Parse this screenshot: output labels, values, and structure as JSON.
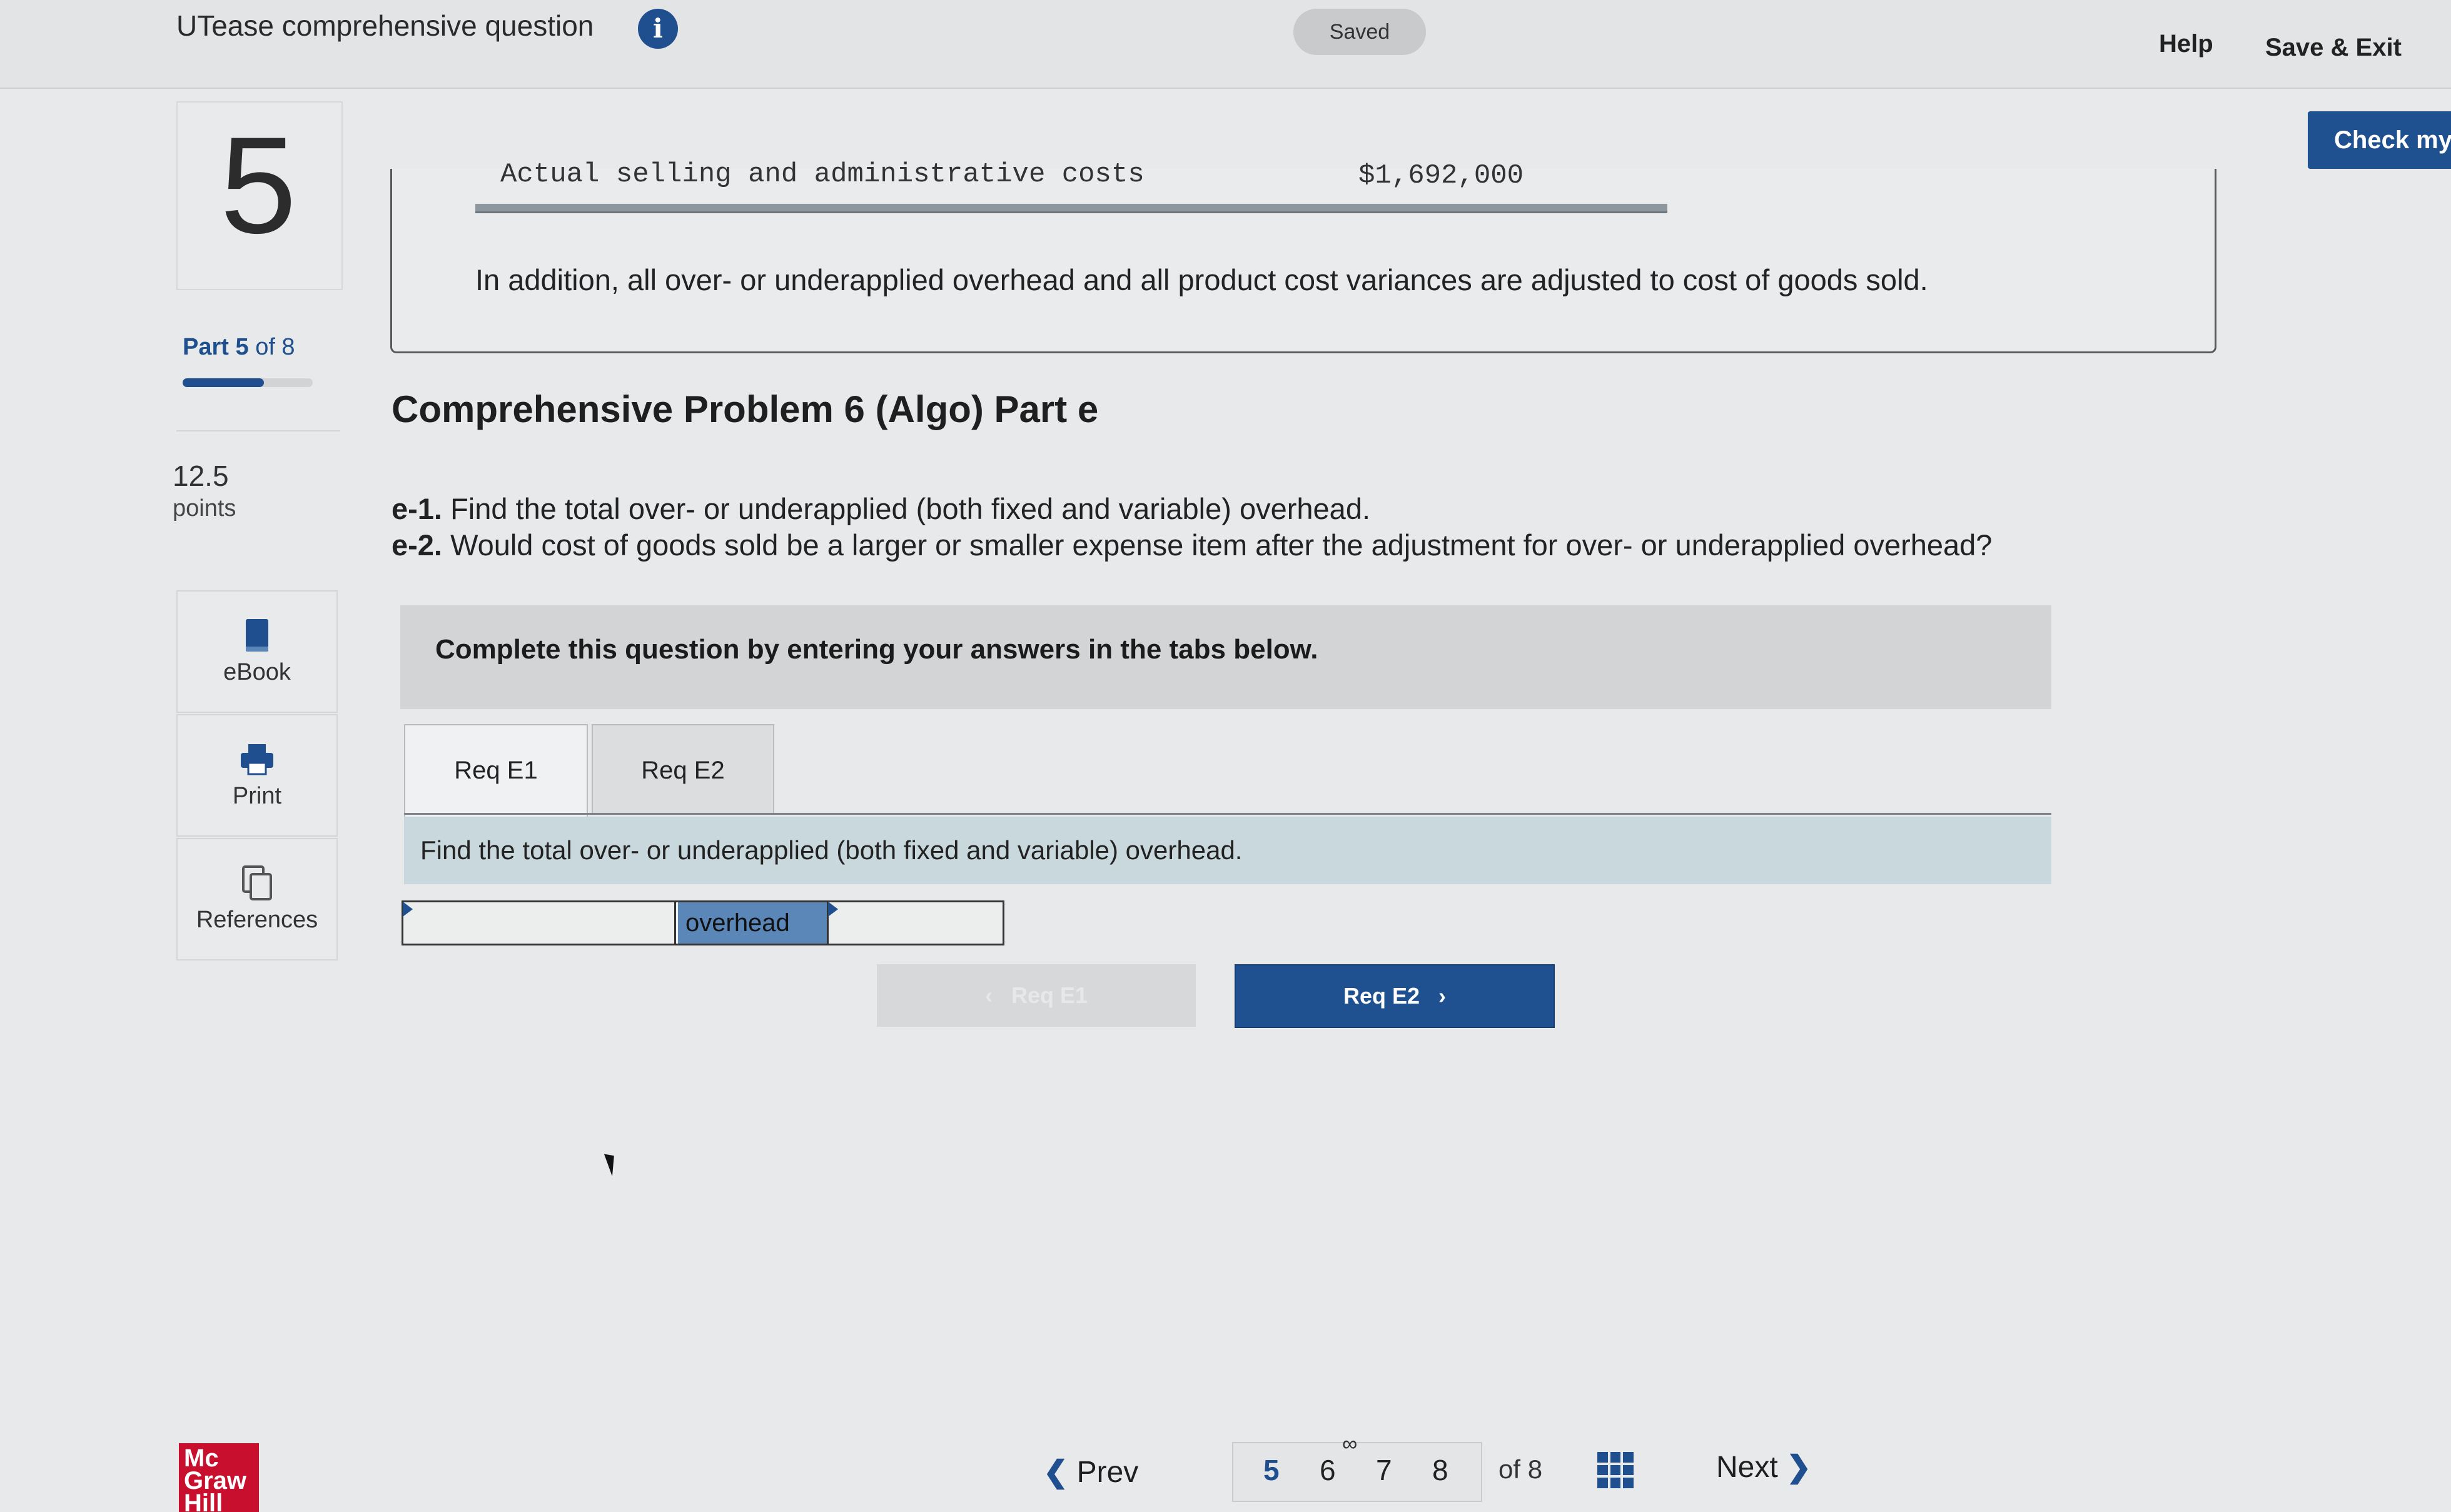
{
  "header": {
    "app_title": "UTease comprehensive question",
    "info_icon": "i",
    "saved": "Saved",
    "help": "Help",
    "save_exit": "Save & Exit",
    "check_my": "Check my"
  },
  "sidebar": {
    "question_number": "5",
    "part_prefix": "Part",
    "part_current": "5",
    "part_suffix": "of 8",
    "part_progress": 0.625,
    "points_value": "12.5",
    "points_label": "points",
    "tools": [
      {
        "label": "eBook",
        "icon": "book-icon"
      },
      {
        "label": "Print",
        "icon": "printer-icon"
      },
      {
        "label": "References",
        "icon": "copy-icon"
      }
    ]
  },
  "content": {
    "table_row_label": "Actual selling and administrative costs",
    "table_row_amount": "$1,692,000",
    "addition_note": "In addition, all over- or underapplied overhead and all product cost variances are adjusted to cost of goods sold.",
    "problem_title": "Comprehensive Problem 6 (Algo) Part e",
    "req_e1_label": "e-1.",
    "req_e1_text": "Find the total over- or underapplied (both fixed and variable) overhead.",
    "req_e2_label": "e-2.",
    "req_e2_text": "Would cost of goods sold be a larger or smaller expense item after the adjustment for over- or underapplied overhead?",
    "instruction": "Complete this question by entering your answers in the tabs below.",
    "tabs": [
      "Req E1",
      "Req E2"
    ],
    "prompt": "Find the total over- or underapplied (both fixed and variable) overhead.",
    "answer": {
      "input1_value": "",
      "middle_label": "overhead",
      "input2_value": ""
    },
    "prev_req_button": "Req E1",
    "next_req_button": "Req E2"
  },
  "footer": {
    "logo": "Mc Graw Hill",
    "prev": "Prev",
    "pages": [
      "5",
      "6",
      "7",
      "8"
    ],
    "current_page": "5",
    "of_total": "of 8",
    "next": "Next"
  },
  "colors": {
    "brand_blue": "#1f5090",
    "overhead_cell": "#5b86b8",
    "logo_red": "#c8102e"
  }
}
